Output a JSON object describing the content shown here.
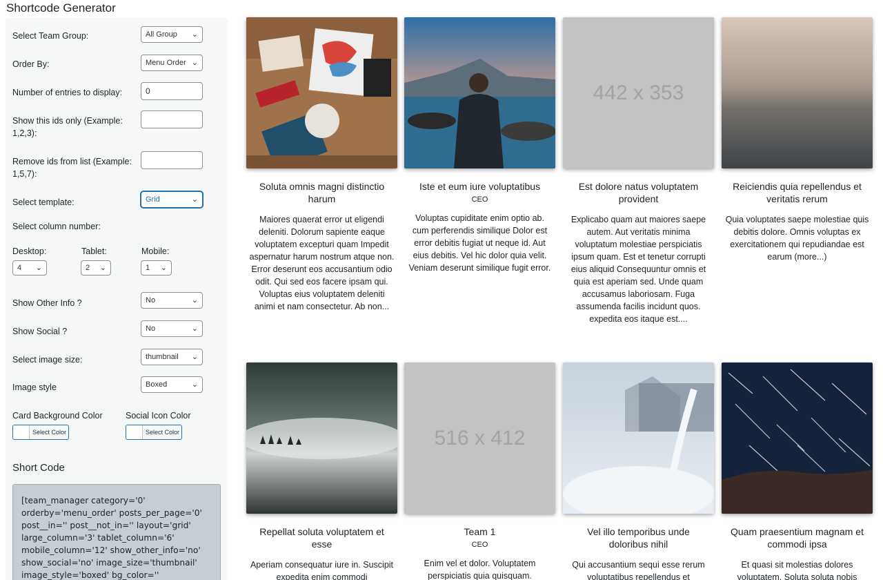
{
  "page": {
    "title": "Shortcode Generator"
  },
  "form": {
    "team_group": {
      "label": "Select Team Group:",
      "value": "All Group"
    },
    "order_by": {
      "label": "Order By:",
      "value": "Menu Order"
    },
    "entries": {
      "label": "Number of entries to display:",
      "value": "0"
    },
    "show_ids": {
      "label": "Show this ids only (Example: 1,2,3):",
      "value": ""
    },
    "remove_ids": {
      "label": "Remove ids from list (Example: 1,5,7):",
      "value": ""
    },
    "template": {
      "label": "Select template:",
      "value": "Grid"
    },
    "column_heading": "Select column number:",
    "desktop": {
      "label": "Desktop:",
      "value": "4"
    },
    "tablet": {
      "label": "Tablet:",
      "value": "2"
    },
    "mobile": {
      "label": "Mobile:",
      "value": "1"
    },
    "other_info": {
      "label": "Show Other Info ?",
      "value": "No"
    },
    "social": {
      "label": "Show Social ?",
      "value": "No"
    },
    "image_size": {
      "label": "Select image size:",
      "value": "thumbnail"
    },
    "image_style": {
      "label": "Image style",
      "value": "Boxed"
    },
    "card_bg": {
      "label": "Card Background Color",
      "button": "Select Color"
    },
    "social_icon": {
      "label": "Social Icon Color",
      "button": "Select Color"
    }
  },
  "shortcode": {
    "title": "Short Code",
    "lines": [
      "[team_manager category='0'",
      "orderby='menu_order' posts_per_page='0'",
      "post__in='' post__not_in='' layout='grid'",
      "large_column='3' tablet_column='6'",
      "mobile_column='12' show_other_info='no'",
      "show_social='no' image_size='thumbnail'",
      "image_style='boxed' bg_color='' social_color='']"
    ]
  },
  "cards": [
    {
      "name": "Soluta omnis magni distinctio harum",
      "role": "",
      "image": "desk-photo",
      "bio": "Maiores quaerat error ut eligendi deleniti. Dolorum sapiente eaque voluptatem excepturi quam Impedit aspernatur harum nostrum atque non. Error deserunt eos accusantium odio odit. Qui sed eos facere ipsam qui. Voluptas eius voluptatem deleniti animi et nam consectetur. Ab non..."
    },
    {
      "name": "Iste et eum iure voluptatibus",
      "role": "CEO",
      "image": "lake-man-photo",
      "bio": "Voluptas cupiditate enim optio ab. cum perferendis similique Dolor est error debitis fugiat ut neque id. Aut eius debitis. Vel hic dolor quia velit. Veniam deserunt similique fugit error."
    },
    {
      "name": "Est dolore natus voluptatem provident",
      "role": "",
      "image": "placeholder",
      "placeholder_text": "442 x 353",
      "bio": "Explicabo quam aut maiores saepe autem. Aut veritatis minima voluptatum molestiae perspiciatis ipsum quam. Est et tenetur corrupti eius aliquid Consequuntur omnis et quia est aperiam sed. Unde quam accusamus laboriosam. Fuga assumenda facilis incidunt quos. expedita eos itaque est...."
    },
    {
      "name": "Reiciendis quia repellendus et veritatis rerum",
      "role": "",
      "image": "sea-fog-photo",
      "bio": "Quia voluptates saepe molestiae quis debitis dolore. Omnis voluptas ex exercitationem qui repudiandae est earum (more...)"
    },
    {
      "name": "Repellat soluta voluptatem et esse",
      "role": "",
      "image": "misty-forest-photo",
      "bio": "Aperiam consequatur iure in. Suscipit expedita enim commodi"
    },
    {
      "name": "Team 1",
      "role": "CEO",
      "image": "placeholder",
      "placeholder_text": "516 x 412",
      "bio": "Enim vel et dolor. Voluptatem perspiciatis quia quisquam."
    },
    {
      "name": "Vel illo temporibus unde doloribus nihil",
      "role": "",
      "image": "frost-plant-photo",
      "bio": "Qui accusantium sequi esse rerum voluptatibus repellendus et"
    },
    {
      "name": "Quam praesentium magnam et commodi ipsa",
      "role": "",
      "image": "star-trails-photo",
      "bio": "Et quasi sit molestias dolores voluptatem. Soluta soluta nobis"
    }
  ]
}
